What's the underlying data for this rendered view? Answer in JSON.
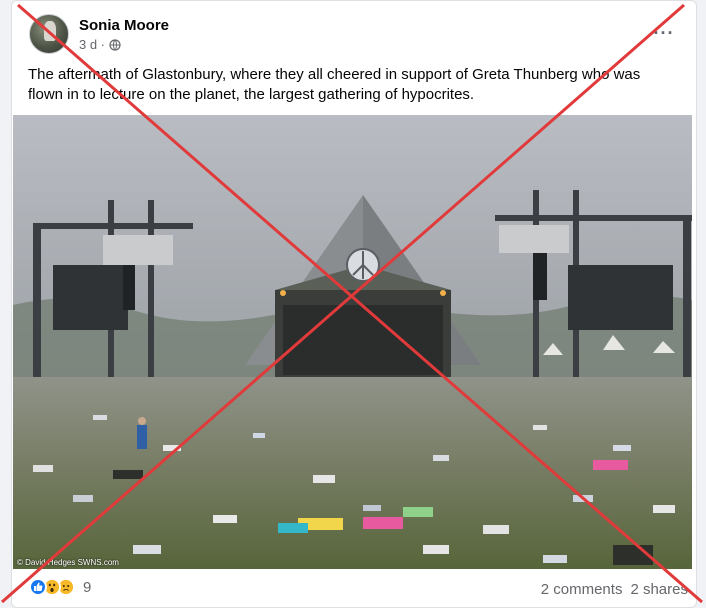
{
  "post": {
    "author": "Sonia Moore",
    "time": "3 d ·",
    "privacy_icon": "globe-icon",
    "more_icon": "more-horizontal-icon",
    "more_label": "···",
    "text": "The aftermath of Glastonbury, where they all cheered in support of Greta Thunberg who was flown in to lecture on the planet, the largest gathering of hypocrites.",
    "photo_credit": "© David Hedges SWNS.com"
  },
  "footer": {
    "reactions": [
      "like-icon",
      "wow-icon",
      "sad-icon"
    ],
    "reaction_count": "9",
    "comments": "2 comments",
    "shares": "2 shares"
  },
  "overlay": {
    "mark": "red-x",
    "color": "#e03a3a"
  }
}
